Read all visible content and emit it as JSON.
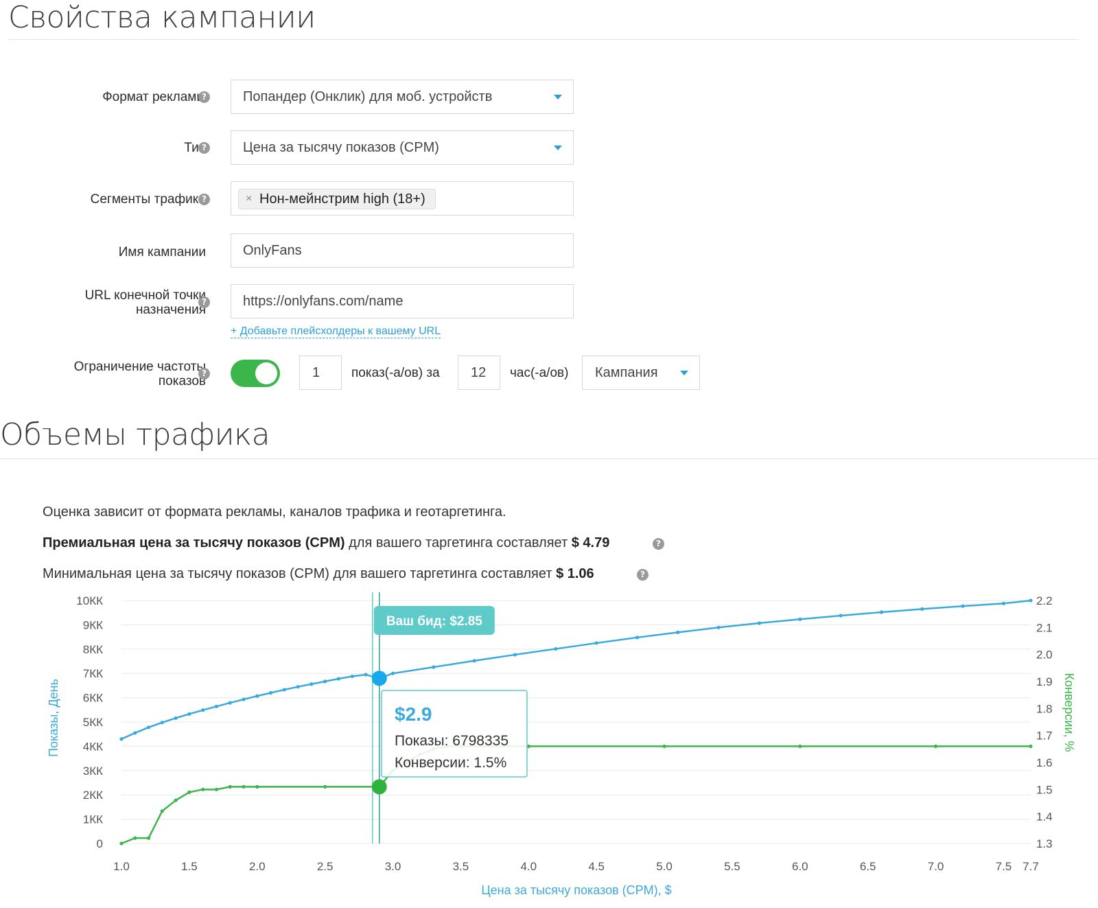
{
  "campaign": {
    "title": "Свойства кампании",
    "format": {
      "label": "Формат рекламы",
      "value": "Попандер (Онклик) для моб. устройств"
    },
    "type": {
      "label": "Тип",
      "value": "Цена за тысячу показов (CPM)"
    },
    "segments": {
      "label": "Сегменты трафика",
      "tag": "Нон-мейнстрим high (18+)",
      "remove": "×"
    },
    "name": {
      "label": "Имя кампании",
      "value": "OnlyFans"
    },
    "url": {
      "label_line1": "URL конечной точки",
      "label_line2": "назначения",
      "value": "https://onlyfans.com/name",
      "placeholder_link": "+ Добавьте плейсхолдеры к вашему URL"
    },
    "freq": {
      "label_line1": "Ограничение частоты",
      "label_line2": "показов",
      "enabled": true,
      "count": "1",
      "per_text": "показ(-а/ов) за",
      "hours": "12",
      "hours_text": "час(-а/ов)",
      "scope": "Кампания"
    },
    "help_glyph": "?"
  },
  "traffic": {
    "title": "Объемы трафика",
    "note": "Оценка зависит от формата рекламы, каналов трафика и геотаргетинга.",
    "premium_bold": "Премиальная цена за тысячу показов (CPM)",
    "premium_rest": " для вашего таргетинга составляет ",
    "premium_value": "$ 4.79",
    "min_text": "Минимальная цена за тысячу показов (CPM) для вашего таргетинга составляет ",
    "min_value": "$ 1.06"
  },
  "chart_data": {
    "type": "line",
    "xlabel": "Цена за тысячу показов (CPM), $",
    "ylabel_left": "Показы, День",
    "ylabel_right": "Конверсии, %",
    "xlim": [
      1.0,
      7.7
    ],
    "ylim_left": [
      0,
      10000000
    ],
    "ylim_right": [
      1.3,
      2.2
    ],
    "x_ticks": [
      "1.0",
      "1.5",
      "2.0",
      "2.5",
      "3.0",
      "3.5",
      "4.0",
      "4.5",
      "5.0",
      "5.5",
      "6.0",
      "6.5",
      "7.0",
      "7.5",
      "7.7"
    ],
    "y_ticks_left": [
      "0",
      "1КК",
      "2КК",
      "3КК",
      "4КК",
      "5КК",
      "6КК",
      "7КК",
      "8КК",
      "9КК",
      "10КК"
    ],
    "y_ticks_right": [
      "1.3",
      "1.4",
      "1.5",
      "1.6",
      "1.7",
      "1.8",
      "1.9",
      "2.0",
      "2.1",
      "2.2"
    ],
    "colors": {
      "impressions": "#3aa9dc",
      "conversions": "#3cb54a",
      "bid": "#5ecbc8"
    },
    "series": [
      {
        "name": "Показы, День",
        "axis": "left",
        "x": [
          1.0,
          1.1,
          1.2,
          1.3,
          1.4,
          1.5,
          1.6,
          1.7,
          1.8,
          1.9,
          2.0,
          2.1,
          2.2,
          2.3,
          2.4,
          2.5,
          2.6,
          2.7,
          2.8,
          2.9,
          3.0,
          3.3,
          3.6,
          3.9,
          4.2,
          4.5,
          4.8,
          5.1,
          5.4,
          5.7,
          6.0,
          6.3,
          6.6,
          6.9,
          7.2,
          7.5,
          7.7
        ],
        "values": [
          4300000,
          4550000,
          4780000,
          4980000,
          5160000,
          5330000,
          5490000,
          5640000,
          5790000,
          5930000,
          6070000,
          6200000,
          6330000,
          6450000,
          6560000,
          6670000,
          6780000,
          6880000,
          6950000,
          6798335,
          7000000,
          7260000,
          7520000,
          7770000,
          8010000,
          8250000,
          8480000,
          8690000,
          8890000,
          9070000,
          9230000,
          9380000,
          9520000,
          9650000,
          9770000,
          9880000,
          10000000
        ]
      },
      {
        "name": "Конверсии, %",
        "axis": "right",
        "x": [
          1.0,
          1.1,
          1.2,
          1.3,
          1.4,
          1.5,
          1.6,
          1.7,
          1.8,
          1.9,
          2.0,
          2.5,
          2.9,
          3.0,
          3.1,
          3.2,
          3.3,
          3.4,
          3.5,
          4.0,
          5.0,
          6.0,
          7.0,
          7.7
        ],
        "values": [
          1.3,
          1.32,
          1.32,
          1.42,
          1.46,
          1.49,
          1.5,
          1.5,
          1.51,
          1.51,
          1.51,
          1.51,
          1.51,
          1.57,
          1.6,
          1.63,
          1.65,
          1.66,
          1.66,
          1.66,
          1.66,
          1.66,
          1.66,
          1.66
        ]
      }
    ],
    "bid_label": "Ваш бид: $2.85",
    "bid_x": 2.85,
    "tooltip": {
      "x": 2.9,
      "price": "$2.9",
      "impressions_text": "Показы: 6798335",
      "conversions_text": "Конверсии: 1.5%"
    }
  }
}
